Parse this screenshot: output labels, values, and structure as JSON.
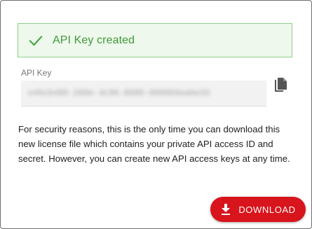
{
  "banner": {
    "message": "API Key created",
    "icon": "check-icon",
    "color": "#3f9a3b"
  },
  "api_key": {
    "label": "API Key",
    "value": "e45cb485-266e-4c96-8685-0966b5eabe33",
    "copy_icon": "copy-icon"
  },
  "notice": {
    "text": "For security reasons, this is the only time you can download this new license file which contains your private API access ID and secret. However, you can create new API access keys at any time."
  },
  "actions": {
    "download_label": "DOWNLOAD",
    "download_icon": "download-icon",
    "accent": "#d8141c"
  }
}
